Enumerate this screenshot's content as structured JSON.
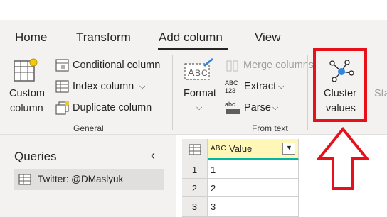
{
  "tabs": [
    {
      "label": "Home"
    },
    {
      "label": "Transform"
    },
    {
      "label": "Add column"
    },
    {
      "label": "View"
    }
  ],
  "active_tab": "Add column",
  "ribbon": {
    "general": {
      "custom_column_line1": "Custom",
      "custom_column_line2": "column",
      "conditional_column": "Conditional column",
      "index_column": "Index column",
      "duplicate_column": "Duplicate column",
      "group_label": "General"
    },
    "from_text": {
      "format": "Format",
      "merge_columns": "Merge columns",
      "extract": "Extract",
      "parse": "Parse",
      "group_label": "From text"
    },
    "cluster": {
      "line1": "Cluster",
      "line2": "values"
    },
    "next_truncated": "Sta"
  },
  "queries": {
    "title": "Queries",
    "items": [
      {
        "label": "Twitter: @DMaslyuk"
      }
    ]
  },
  "grid": {
    "column_header": "Value",
    "type_icon_text": "A B C",
    "rows": [
      {
        "num": "1",
        "value": "1"
      },
      {
        "num": "2",
        "value": "2"
      },
      {
        "num": "3",
        "value": "3"
      }
    ]
  },
  "colors": {
    "highlight": "#e8101a",
    "accent_node": "#2e86de",
    "column_header_bg": "#fff7b8",
    "column_header_line": "#00b7a0"
  }
}
